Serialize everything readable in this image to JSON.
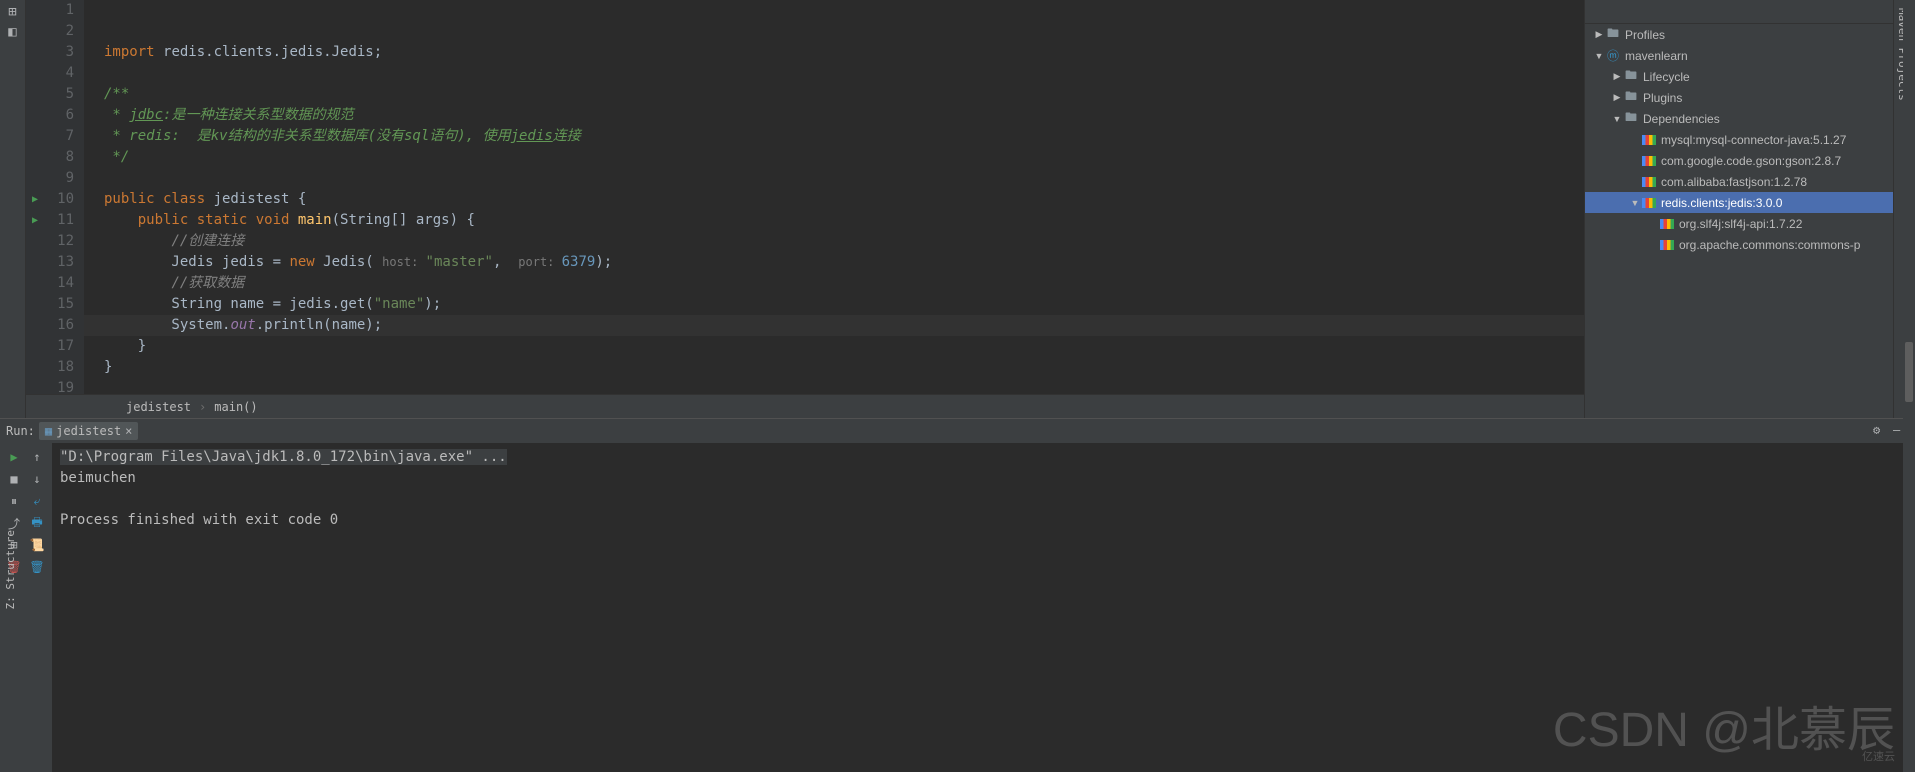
{
  "editor": {
    "lines": [
      {
        "n": 1,
        "type": "hidden"
      },
      {
        "n": 2,
        "type": "blank"
      },
      {
        "n": 3,
        "segments": [
          {
            "t": "import ",
            "c": "kw"
          },
          {
            "t": "redis.clients.jedis.Jedis;",
            "c": ""
          }
        ]
      },
      {
        "n": 4,
        "type": "blank"
      },
      {
        "n": 5,
        "segments": [
          {
            "t": "/**",
            "c": "jdoc"
          }
        ]
      },
      {
        "n": 6,
        "segments": [
          {
            "t": " * ",
            "c": "jdoc"
          },
          {
            "t": "jdbc",
            "c": "jdoc jdoc-u"
          },
          {
            "t": ":是一种连接关系型数据的规范",
            "c": "jdoc"
          }
        ]
      },
      {
        "n": 7,
        "segments": [
          {
            "t": " * redis:  是kv结构的非关系型数据库(没有sql语句), 使用",
            "c": "jdoc"
          },
          {
            "t": "jedis",
            "c": "jdoc jdoc-u"
          },
          {
            "t": "连接",
            "c": "jdoc"
          }
        ]
      },
      {
        "n": 8,
        "segments": [
          {
            "t": " */",
            "c": "jdoc"
          }
        ]
      },
      {
        "n": 9,
        "type": "blank"
      },
      {
        "n": 10,
        "run": true,
        "segments": [
          {
            "t": "public class ",
            "c": "kw"
          },
          {
            "t": "jedistest {",
            "c": ""
          }
        ]
      },
      {
        "n": 11,
        "run": true,
        "segments": [
          {
            "t": "    ",
            "c": ""
          },
          {
            "t": "public static void ",
            "c": "kw"
          },
          {
            "t": "main",
            "c": "method"
          },
          {
            "t": "(String[] args) {",
            "c": ""
          }
        ]
      },
      {
        "n": 12,
        "segments": [
          {
            "t": "        ",
            "c": ""
          },
          {
            "t": "//创建连接",
            "c": "cmt"
          }
        ]
      },
      {
        "n": 13,
        "segments": [
          {
            "t": "        Jedis jedis = ",
            "c": ""
          },
          {
            "t": "new ",
            "c": "kw"
          },
          {
            "t": "Jedis( ",
            "c": ""
          },
          {
            "t": "host: ",
            "c": "hint"
          },
          {
            "t": "\"master\"",
            "c": "str"
          },
          {
            "t": ",  ",
            "c": ""
          },
          {
            "t": "port: ",
            "c": "hint"
          },
          {
            "t": "6379",
            "c": "num"
          },
          {
            "t": ");",
            "c": ""
          }
        ]
      },
      {
        "n": 14,
        "segments": [
          {
            "t": "        ",
            "c": ""
          },
          {
            "t": "//获取数据",
            "c": "cmt"
          }
        ]
      },
      {
        "n": 15,
        "segments": [
          {
            "t": "        String name = jedis.get(",
            "c": ""
          },
          {
            "t": "\"name\"",
            "c": "str"
          },
          {
            "t": ");",
            "c": ""
          }
        ]
      },
      {
        "n": 16,
        "caret": true,
        "segments": [
          {
            "t": "        System.",
            "c": ""
          },
          {
            "t": "out",
            "c": "field"
          },
          {
            "t": ".println(name);",
            "c": ""
          }
        ]
      },
      {
        "n": 17,
        "segments": [
          {
            "t": "    }",
            "c": ""
          }
        ]
      },
      {
        "n": 18,
        "segments": [
          {
            "t": "}",
            "c": ""
          }
        ]
      },
      {
        "n": 19,
        "type": "blank"
      }
    ],
    "breadcrumb": [
      "jedistest",
      "main()"
    ]
  },
  "maven": {
    "nodes": [
      {
        "indent": 0,
        "arrow": "▶",
        "icon": "folder",
        "label": "Profiles"
      },
      {
        "indent": 0,
        "arrow": "▼",
        "icon": "maven",
        "label": "mavenlearn"
      },
      {
        "indent": 1,
        "arrow": "▶",
        "icon": "folder",
        "label": "Lifecycle"
      },
      {
        "indent": 1,
        "arrow": "▶",
        "icon": "folder",
        "label": "Plugins"
      },
      {
        "indent": 1,
        "arrow": "▼",
        "icon": "folder",
        "label": "Dependencies"
      },
      {
        "indent": 2,
        "arrow": "",
        "icon": "lib",
        "label": "mysql:mysql-connector-java:5.1.27"
      },
      {
        "indent": 2,
        "arrow": "",
        "icon": "lib",
        "label": "com.google.code.gson:gson:2.8.7"
      },
      {
        "indent": 2,
        "arrow": "",
        "icon": "lib",
        "label": "com.alibaba:fastjson:1.2.78"
      },
      {
        "indent": 2,
        "arrow": "▼",
        "icon": "lib",
        "label": "redis.clients:jedis:3.0.0",
        "sel": true
      },
      {
        "indent": 3,
        "arrow": "",
        "icon": "lib",
        "label": "org.slf4j:slf4j-api:1.7.22"
      },
      {
        "indent": 3,
        "arrow": "",
        "icon": "lib",
        "label": "org.apache.commons:commons-p"
      }
    ],
    "rail_label": "Maven Projects"
  },
  "run": {
    "title": "Run:",
    "tab": "jedistest",
    "output_cmd": "\"D:\\Program Files\\Java\\jdk1.8.0_172\\bin\\java.exe\" ...",
    "output_lines": [
      "beimuchen",
      "",
      "Process finished with exit code 0"
    ]
  },
  "left_vertical": "Z: Structure",
  "watermark": "CSDN @北慕辰",
  "watermark2": "亿速云"
}
